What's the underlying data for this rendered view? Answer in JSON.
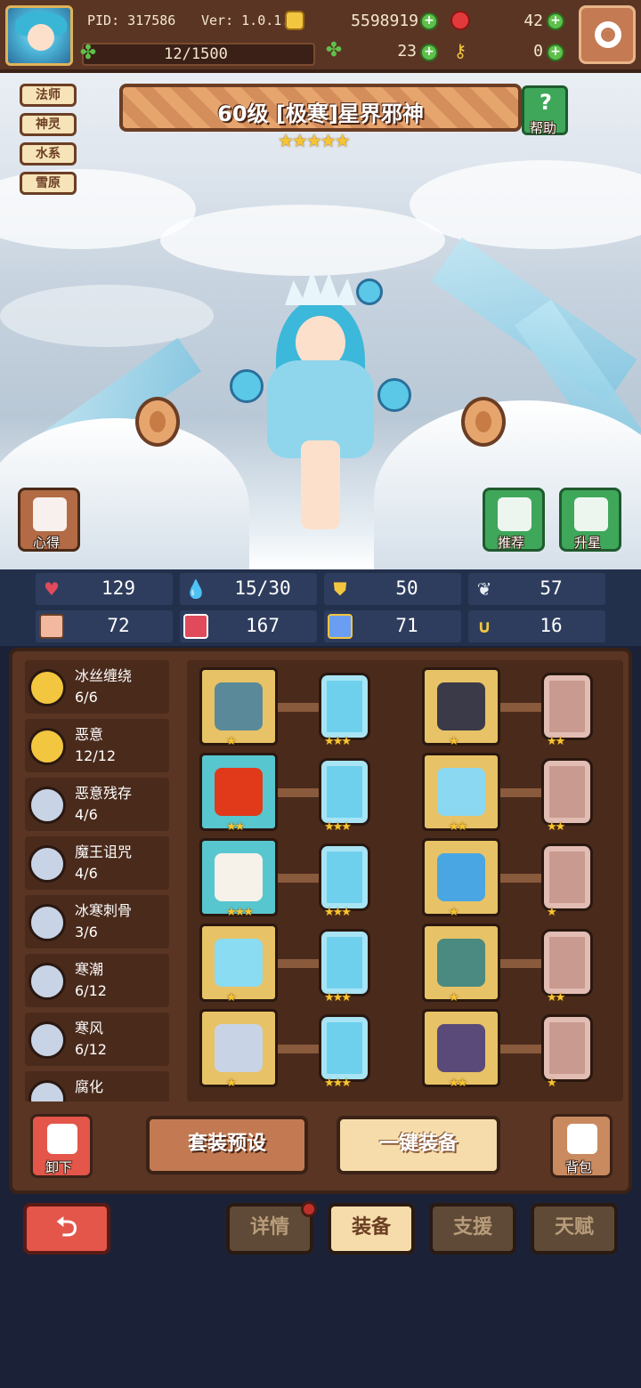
{
  "hud": {
    "pid": "PID: 317586",
    "version": "Ver: 1.0.1.0",
    "coins": "5598919",
    "gems": "42",
    "exp": "12/1500",
    "clovers": "23",
    "keys": "0"
  },
  "tags": [
    "法师",
    "神灵",
    "水系",
    "雪原"
  ],
  "hero": {
    "title": "60级 [极寒]星界邪神",
    "stars": 5,
    "star_glyphs": "★★★★★",
    "help_label": "帮助"
  },
  "side_buttons": {
    "insight": "心得",
    "recommend": "推荐",
    "upgrade": "升星"
  },
  "stats": [
    {
      "icon": "heart-icon",
      "value": "129",
      "color": "#e04a5a"
    },
    {
      "icon": "droplet-icon",
      "value": "15/30",
      "color": "#6ad0f2"
    },
    {
      "icon": "shield-icon",
      "value": "50",
      "color": "#f3c640"
    },
    {
      "icon": "wing-icon",
      "value": "57",
      "color": "#e8eef4"
    },
    {
      "icon": "fist-icon",
      "value": "72",
      "color": "#f3b8a0"
    },
    {
      "icon": "book-icon",
      "value": "167",
      "color": "#e04a5a"
    },
    {
      "icon": "scroll-icon",
      "value": "71",
      "color": "#6a9ef2"
    },
    {
      "icon": "horseshoe-icon",
      "value": "16",
      "color": "#f3c640"
    }
  ],
  "sets": [
    {
      "name": "冰丝缠绕",
      "count": "6/6",
      "color": "#f3c640"
    },
    {
      "name": "恶意",
      "count": "12/12",
      "color": "#f3c640"
    },
    {
      "name": "恶意残存",
      "count": "4/6",
      "color": "#c8d4e6"
    },
    {
      "name": "魔王诅咒",
      "count": "4/6",
      "color": "#c8d4e6"
    },
    {
      "name": "冰寒刺骨",
      "count": "3/6",
      "color": "#c8d4e6"
    },
    {
      "name": "寒潮",
      "count": "6/12",
      "color": "#c8d4e6"
    },
    {
      "name": "寒风",
      "count": "6/12",
      "color": "#c8d4e6"
    },
    {
      "name": "腐化",
      "count": "",
      "color": "#c8d4e6"
    }
  ],
  "equipment": [
    {
      "slot_bg": "gold",
      "item_color": "#5a8a9a",
      "item_icon": "staff-icon",
      "stars": "★",
      "rune": "blue",
      "rune_stars": "★★★"
    },
    {
      "slot_bg": "gold",
      "item_color": "#3a3a48",
      "item_icon": "helmet-icon",
      "stars": "★",
      "rune": "pink",
      "rune_stars": "★★"
    },
    {
      "slot_bg": "teal",
      "item_color": "#e03a1a",
      "item_icon": "orb-icon",
      "stars": "★★",
      "rune": "blue",
      "rune_stars": "★★★"
    },
    {
      "slot_bg": "gold",
      "item_color": "#8ad8f2",
      "item_icon": "armor-icon",
      "stars": "★★",
      "rune": "pink",
      "rune_stars": "★★"
    },
    {
      "slot_bg": "teal",
      "item_color": "#f6f2ea",
      "item_icon": "necklace-icon",
      "stars": "★★★",
      "rune": "blue",
      "rune_stars": "★★★"
    },
    {
      "slot_bg": "gold",
      "item_color": "#4aa6e2",
      "item_icon": "cape-icon",
      "stars": "★",
      "rune": "pink",
      "rune_stars": "★"
    },
    {
      "slot_bg": "gold",
      "item_color": "#8adcf2",
      "item_icon": "crystal-icon",
      "stars": "★",
      "rune": "blue",
      "rune_stars": "★★★"
    },
    {
      "slot_bg": "gold",
      "item_color": "#4a8a80",
      "item_icon": "belt-icon",
      "stars": "★",
      "rune": "pink",
      "rune_stars": "★★"
    },
    {
      "slot_bg": "gold",
      "item_color": "#c8d4e6",
      "item_icon": "ring-icon",
      "stars": "★",
      "rune": "blue",
      "rune_stars": "★★★"
    },
    {
      "slot_bg": "gold",
      "item_color": "#5a4a7a",
      "item_icon": "boots-icon",
      "stars": "★★",
      "rune": "pink",
      "rune_stars": "★"
    }
  ],
  "actions": {
    "unequip": "卸下",
    "set_preset": "套装预设",
    "one_click_equip": "一键装备",
    "backpack": "背包"
  },
  "tabs": [
    {
      "label": "详情",
      "active": false,
      "notification": true
    },
    {
      "label": "装备",
      "active": true,
      "notification": false
    },
    {
      "label": "支援",
      "active": false,
      "notification": false
    },
    {
      "label": "天赋",
      "active": false,
      "notification": false
    }
  ],
  "back_glyph": "⮌"
}
